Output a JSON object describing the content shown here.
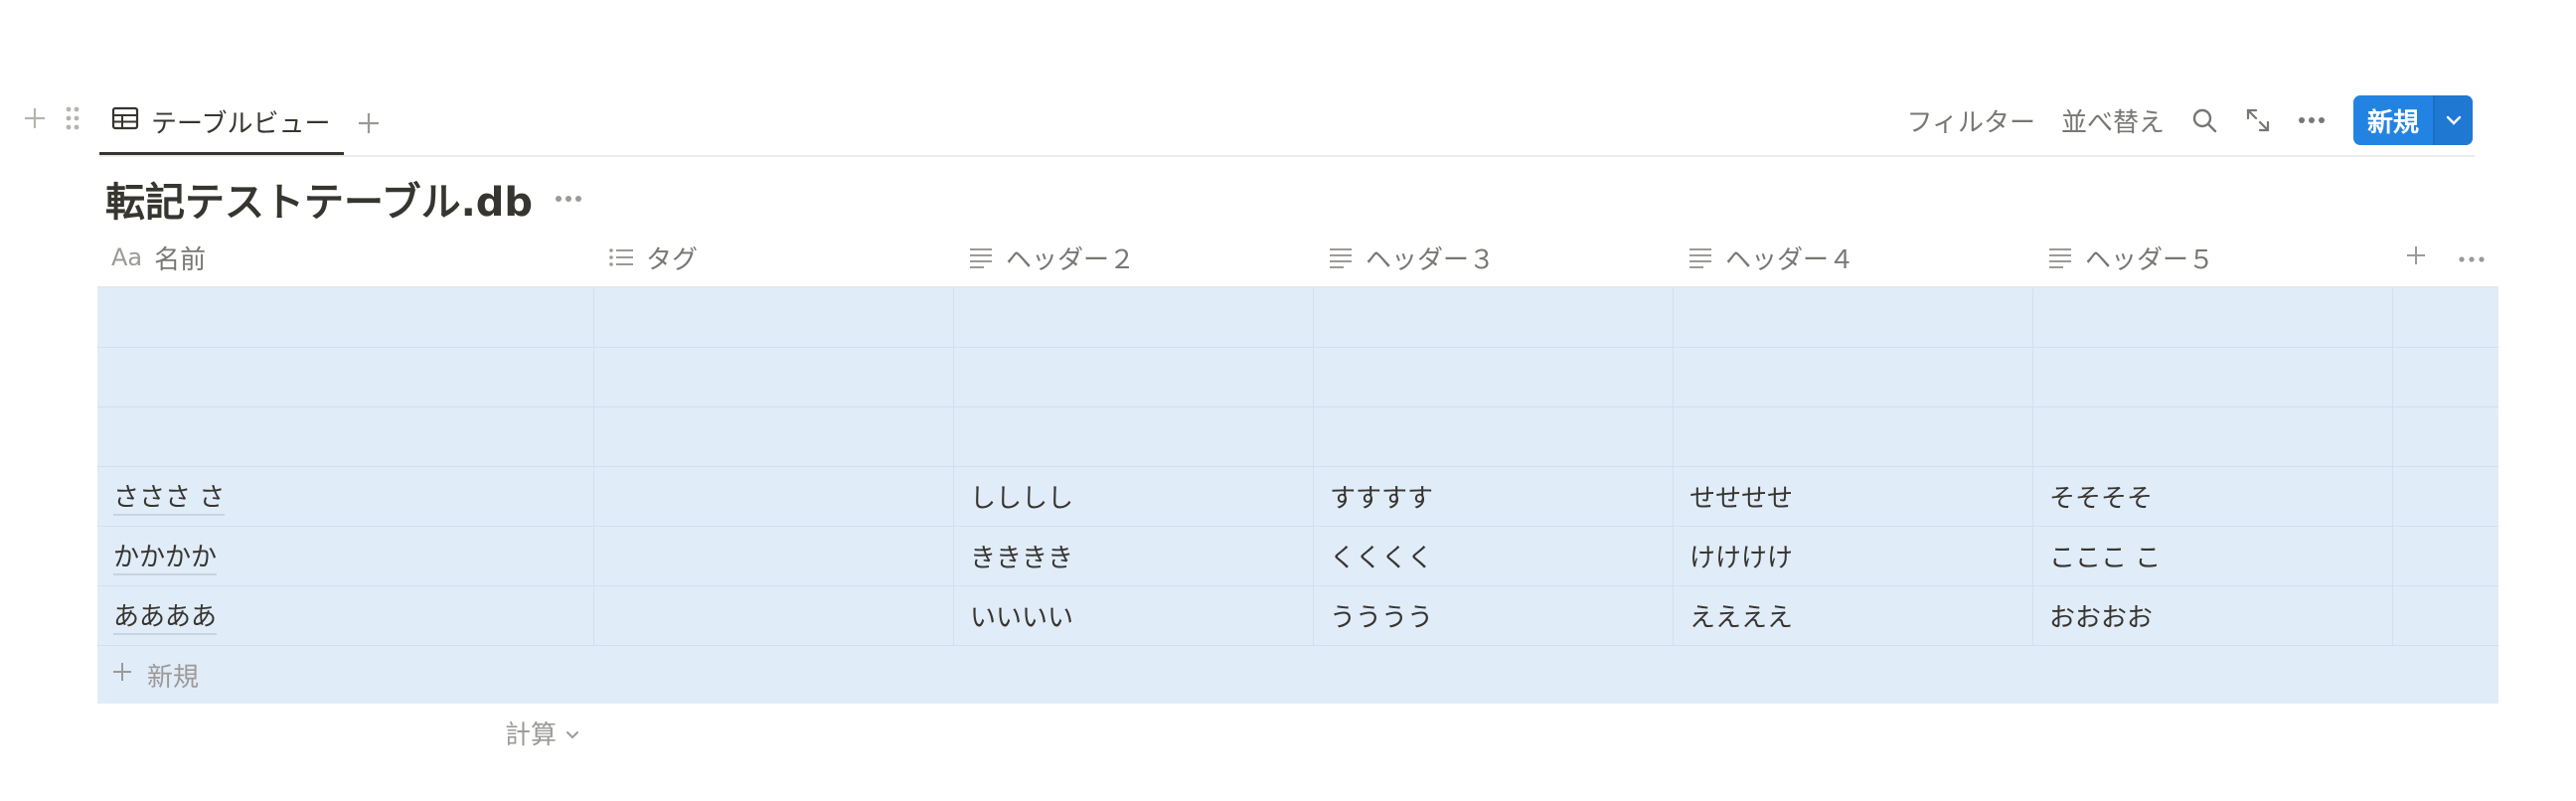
{
  "view": {
    "tab_label": "テーブルビュー"
  },
  "toolbar": {
    "filter_label": "フィルター",
    "sort_label": "並べ替え",
    "new_label": "新規"
  },
  "database": {
    "title": "転記テストテーブル.db"
  },
  "table": {
    "columns": [
      {
        "label": "名前",
        "icon": "aa-icon"
      },
      {
        "label": "タグ",
        "icon": "list-icon"
      },
      {
        "label": "ヘッダー２",
        "icon": "text-lines-icon"
      },
      {
        "label": "ヘッダー３",
        "icon": "text-lines-icon"
      },
      {
        "label": "ヘッダー４",
        "icon": "text-lines-icon"
      },
      {
        "label": "ヘッダー５",
        "icon": "text-lines-icon"
      }
    ],
    "name_icon_text": "Aa",
    "rows": [
      [
        "",
        "",
        "",
        "",
        "",
        ""
      ],
      [
        "",
        "",
        "",
        "",
        "",
        ""
      ],
      [
        "",
        "",
        "",
        "",
        "",
        ""
      ],
      [
        "さささ さ",
        "",
        "しししし",
        "すすすす",
        "せせせせ",
        "そそそそ"
      ],
      [
        "かかかか",
        "",
        "きききき",
        "くくくく",
        "けけけけ",
        "こここ こ"
      ],
      [
        "ああああ",
        "",
        "いいいい",
        "うううう",
        "ええええ",
        "おおおお"
      ]
    ],
    "new_row_label": "新規",
    "calc_label": "計算"
  }
}
